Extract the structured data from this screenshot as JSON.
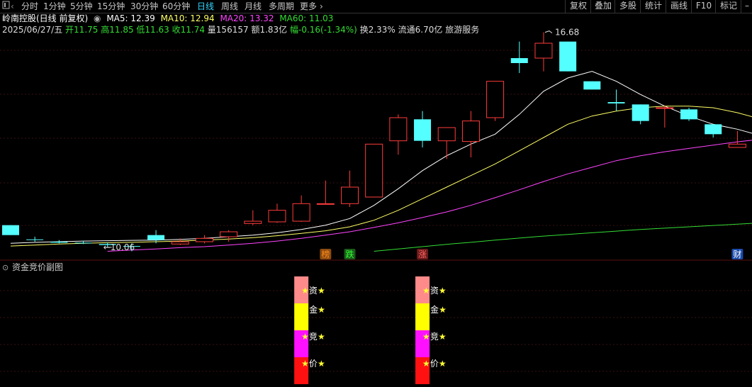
{
  "toolbar": {
    "left_icon": "window-icon",
    "prev_icon": "chevron-left-icon",
    "periods": [
      "分时",
      "1分钟",
      "5分钟",
      "15分钟",
      "30分钟",
      "60分钟",
      "日线",
      "周线",
      "月线",
      "多周期",
      "更多"
    ],
    "active_period": "日线",
    "more_arrow": "›",
    "right_buttons": [
      "复权",
      "叠加",
      "多股",
      "统计",
      "画线",
      "F10",
      "标记"
    ],
    "minus_icon": "minus-icon"
  },
  "header": {
    "stock": "岭南控股(日线 前复权)",
    "ma5": "MA5: 12.39",
    "ma10": "MA10: 12.94",
    "ma20": "MA20: 13.32",
    "ma60": "MA60: 11.03",
    "date": "2025/06/27/五",
    "open": "开11.75",
    "high": "高11.85",
    "low": "低11.63",
    "close": "收11.74",
    "volume": "量156157",
    "amount": "额1.83亿",
    "change": "幅-0.16(-1.34%)",
    "turnover": "换2.33%",
    "float_cap": "流通6.70亿",
    "sector": "旅游服务"
  },
  "colors": {
    "up": "#ff3b3b",
    "down": "#54ffff",
    "ma5": "#ffffff",
    "ma10": "#ffff66",
    "ma20": "#ff44ff",
    "ma60": "#33dd33",
    "grid": "#3a1010"
  },
  "chart_data": {
    "type": "candlestick",
    "price_range": [
      9.9,
      17.1
    ],
    "candles": [
      {
        "o": 10.85,
        "h": 10.85,
        "l": 10.55,
        "c": 10.55
      },
      {
        "o": 10.42,
        "h": 10.5,
        "l": 10.35,
        "c": 10.4
      },
      {
        "o": 10.35,
        "h": 10.4,
        "l": 10.3,
        "c": 10.32
      },
      {
        "o": 10.32,
        "h": 10.38,
        "l": 10.28,
        "c": 10.3
      },
      {
        "o": 10.28,
        "h": 10.33,
        "l": 10.18,
        "c": 10.25
      },
      {
        "o": 10.22,
        "h": 10.3,
        "l": 10.06,
        "c": 10.2
      },
      {
        "o": 10.55,
        "h": 10.7,
        "l": 10.3,
        "c": 10.4
      },
      {
        "o": 10.28,
        "h": 10.45,
        "l": 10.25,
        "c": 10.35
      },
      {
        "o": 10.35,
        "h": 10.55,
        "l": 10.3,
        "c": 10.45
      },
      {
        "o": 10.5,
        "h": 10.7,
        "l": 10.35,
        "c": 10.65
      },
      {
        "o": 10.9,
        "h": 11.3,
        "l": 10.85,
        "c": 10.97
      },
      {
        "o": 10.95,
        "h": 11.5,
        "l": 10.92,
        "c": 11.3
      },
      {
        "o": 10.97,
        "h": 11.75,
        "l": 10.95,
        "c": 11.5
      },
      {
        "o": 11.5,
        "h": 12.2,
        "l": 11.5,
        "c": 11.5
      },
      {
        "o": 11.5,
        "h": 12.5,
        "l": 11.4,
        "c": 12.0
      },
      {
        "o": 11.7,
        "h": 13.3,
        "l": 11.7,
        "c": 13.3
      },
      {
        "o": 13.4,
        "h": 14.2,
        "l": 12.98,
        "c": 14.1
      },
      {
        "o": 14.05,
        "h": 14.3,
        "l": 13.2,
        "c": 13.4
      },
      {
        "o": 13.4,
        "h": 13.75,
        "l": 12.85,
        "c": 13.8
      },
      {
        "o": 13.38,
        "h": 14.3,
        "l": 12.9,
        "c": 14.0
      },
      {
        "o": 14.1,
        "h": 15.2,
        "l": 14.0,
        "c": 15.2
      },
      {
        "o": 15.9,
        "h": 16.4,
        "l": 15.45,
        "c": 15.75
      },
      {
        "o": 15.9,
        "h": 16.68,
        "l": 15.5,
        "c": 16.35
      },
      {
        "o": 16.4,
        "h": 16.4,
        "l": 15.5,
        "c": 15.5
      },
      {
        "o": 15.2,
        "h": 15.2,
        "l": 14.95,
        "c": 14.95
      },
      {
        "o": 14.57,
        "h": 14.95,
        "l": 14.3,
        "c": 14.53
      },
      {
        "o": 14.5,
        "h": 14.5,
        "l": 13.9,
        "c": 14.0
      },
      {
        "o": 14.4,
        "h": 14.45,
        "l": 13.8,
        "c": 14.4
      },
      {
        "o": 14.35,
        "h": 14.4,
        "l": 14.0,
        "c": 14.05
      },
      {
        "o": 13.9,
        "h": 13.9,
        "l": 13.5,
        "c": 13.6
      },
      {
        "o": 13.2,
        "h": 13.7,
        "l": 13.2,
        "c": 13.3
      },
      {
        "o": 13.5,
        "h": 13.6,
        "l": 13.2,
        "c": 13.35
      },
      {
        "o": 13.75,
        "h": 13.75,
        "l": 12.85,
        "c": 12.85
      },
      {
        "o": 12.73,
        "h": 12.85,
        "l": 12.55,
        "c": 12.85
      }
    ],
    "ma_lines": [
      {
        "name": "MA5",
        "color_key": "ma5",
        "start": 0,
        "values": [
          10.3,
          10.33,
          10.35,
          10.37,
          10.38,
          10.39,
          10.4,
          10.42,
          10.45,
          10.5,
          10.55,
          10.62,
          10.72,
          10.85,
          11.05,
          11.45,
          11.95,
          12.5,
          12.95,
          13.3,
          13.6,
          14.2,
          14.9,
          15.3,
          15.5,
          15.2,
          14.8,
          14.45,
          14.15,
          13.9,
          13.75,
          13.55,
          13.3,
          13.05
        ]
      },
      {
        "name": "MA10",
        "color_key": "ma10",
        "start": 0,
        "values": [
          10.22,
          10.25,
          10.28,
          10.3,
          10.32,
          10.33,
          10.35,
          10.37,
          10.4,
          10.43,
          10.47,
          10.53,
          10.6,
          10.68,
          10.8,
          11.0,
          11.3,
          11.65,
          12.0,
          12.35,
          12.7,
          13.1,
          13.5,
          13.9,
          14.15,
          14.3,
          14.4,
          14.45,
          14.45,
          14.4,
          14.25,
          14.05,
          13.8,
          13.5
        ]
      },
      {
        "name": "MA20",
        "color_key": "ma20",
        "start": 4,
        "values": [
          10.06,
          10.1,
          10.13,
          10.17,
          10.2,
          10.25,
          10.3,
          10.37,
          10.45,
          10.55,
          10.65,
          10.78,
          10.92,
          11.08,
          11.25,
          11.45,
          11.68,
          11.92,
          12.17,
          12.4,
          12.6,
          12.8,
          12.95,
          13.07,
          13.17,
          13.27,
          13.37,
          13.45,
          13.55,
          13.65
        ]
      },
      {
        "name": "MA60",
        "color_key": "ma60",
        "start": 15,
        "values": [
          10.06,
          10.13,
          10.2,
          10.27,
          10.33,
          10.4,
          10.46,
          10.52,
          10.57,
          10.62,
          10.67,
          10.72,
          10.76,
          10.8,
          10.84,
          10.88,
          10.92,
          10.96,
          11.0
        ]
      }
    ],
    "annotations": {
      "high_label": "16.68",
      "low_label": "10.06",
      "high_index": 22,
      "low_index": 4
    },
    "event_marks": [
      {
        "label": "榜",
        "index": 13,
        "color": "#ff8c1a",
        "bg": "#8a4a10"
      },
      {
        "label": "跌",
        "index": 14,
        "color": "#33ff33",
        "bg": "#1a5a1a"
      },
      {
        "label": "涨",
        "index": 17,
        "color": "#ff6666",
        "bg": "#6a1a1a"
      },
      {
        "label": "财",
        "index": 30,
        "color": "#ffffff",
        "bg": "#1a4aaa"
      }
    ],
    "sub_chart": {
      "title": "资金竞价副图",
      "columns": [
        {
          "index": 12
        },
        {
          "index": 17
        }
      ],
      "labels": [
        "资",
        "金",
        "竞",
        "价"
      ],
      "star": "★",
      "segment_colors": [
        "#ff8a8a",
        "#ffff00",
        "#ff11ff",
        "#ff1111"
      ]
    }
  }
}
